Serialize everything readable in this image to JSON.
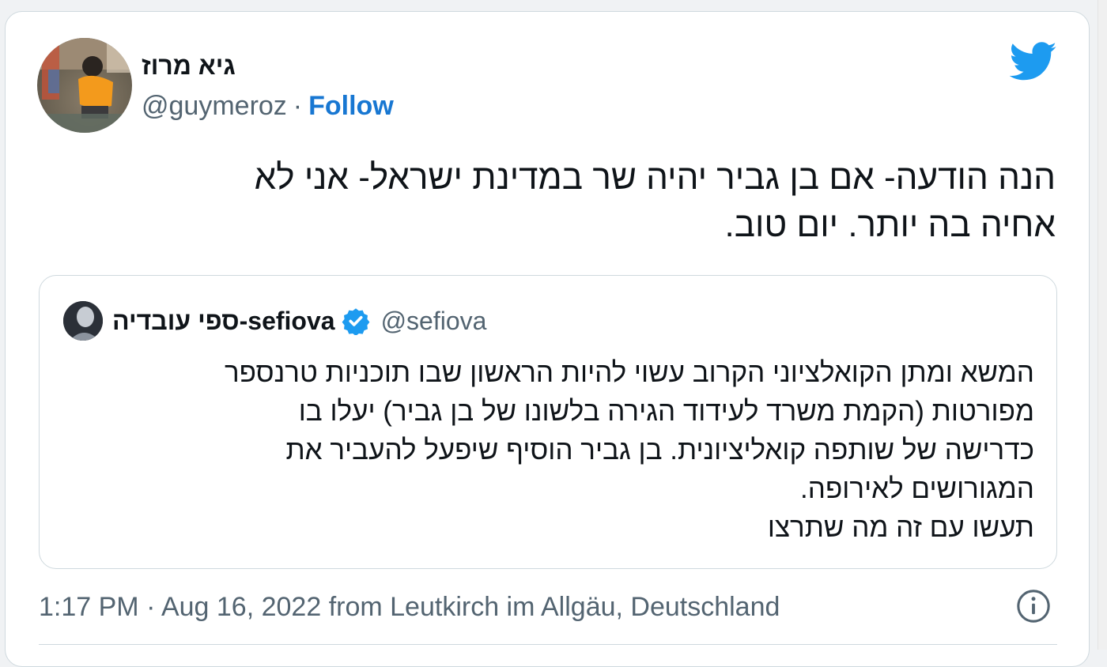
{
  "author": {
    "name": "גיא מרוז",
    "handle": "@guymeroz",
    "separator": "·",
    "follow_label": "Follow"
  },
  "tweet": {
    "lines": [
      "הנה הודעה- אם בן גביר יהיה שר במדינת ישראל- אני לא",
      "אחיה בה יותר. יום טוב."
    ]
  },
  "quoted": {
    "name": "ספי עובדיה-sefiova",
    "handle": "@sefiova",
    "lines": [
      "המשא ומתן הקואלציוני הקרוב עשוי להיות הראשון שבו תוכניות טרנספר",
      "מפורטות (הקמת משרד לעידוד הגירה בלשונו של בן גביר) יעלו בו",
      "כדרישה של שותפה קואליציונית. בן גביר הוסיף שיפעל להעביר את",
      "המגורושים לאירופה.",
      "תעשו עם זה מה שתרצו"
    ]
  },
  "meta": {
    "timestamp": "1:17 PM · Aug 16, 2022 from Leutkirch im Allgäu, Deutschland"
  },
  "icons": {
    "brand": "twitter-bird-icon",
    "verified": "verified-badge-icon",
    "info": "info-icon"
  },
  "colors": {
    "twitter_blue": "#1d9bf0",
    "follow_link": "#1877d2",
    "text": "#0f1419",
    "secondary": "#536471",
    "border": "#cfd9de"
  }
}
